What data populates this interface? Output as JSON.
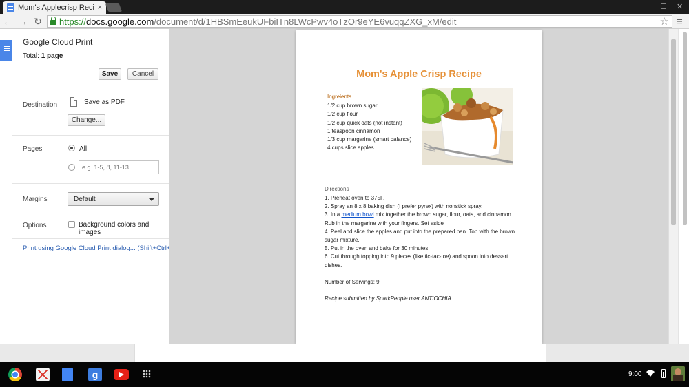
{
  "browser": {
    "tab_title": "Mom's Applecrisp Recipe",
    "tab_close": "×",
    "url_scheme": "https://",
    "url_host": "docs.google.com",
    "url_path": "/document/d/1HBSmEeukUFbiITn8LWcPwv4oTzOr9eYE6vuqqZXG_xM/edit",
    "back": "←",
    "forward": "→",
    "reload": "↻",
    "star": "☆",
    "menu": "≡",
    "minimize": "—",
    "maximize": "☐",
    "close": "✕"
  },
  "print_dialog": {
    "title": "Google Cloud Print",
    "total_label": "Total:",
    "total_value": "1 page",
    "save_label": "Save",
    "cancel_label": "Cancel",
    "destination_label": "Destination",
    "destination_value": "Save as PDF",
    "change_label": "Change...",
    "pages_label": "Pages",
    "pages_all_label": "All",
    "pages_placeholder": "e.g. 1-5, 8, 11-13",
    "margins_label": "Margins",
    "margins_value": "Default",
    "options_label": "Options",
    "background_option": "Background colors and images",
    "cloud_print_link": "Print using Google Cloud Print dialog... (Shift+Ctrl+P)"
  },
  "document": {
    "title": "Mom's Apple Crisp Recipe",
    "ingredients_heading": "Ingreients",
    "ingredients": [
      "1/2 cup brown sugar",
      "1/2 cup flour",
      "1/2 cup quick oats (not instant)",
      "1 teaspoon cinnamon",
      "1/3 cup margarine (smart balance)",
      "4 cups slice apples"
    ],
    "directions_heading": "Directions",
    "directions": [
      "1. Preheat oven to 375F.",
      "2. Spray an 8 x 8 baking dish (I prefer pyrex) with nonstick spray.",
      "4. Peel and slice the apples and put into the prepared pan. Top with the brown sugar mixture.",
      "5. Put in the oven and bake for 30 minutes.",
      "6. Cut through topping into 9 pieces (like tic-tac-toe) and spoon into dessert dishes."
    ],
    "direction_3_pre": "3. In a ",
    "direction_3_link": "medium bowl",
    "direction_3_post": " mix together the brown sugar, flour, oats, and cinnamon. Rub in the margarine with your fingers. Set aside",
    "servings": "Number of Servings: 9",
    "submitted": "Recipe submitted by SparkPeople user ANTIOCHIA."
  },
  "shelf": {
    "time": "9:00",
    "apps": [
      "chrome-icon",
      "gmail-icon",
      "docs-icon",
      "google-plus-icon",
      "youtube-icon",
      "app-launcher-icon"
    ],
    "gplus_glyph": "g"
  },
  "colors": {
    "title_orange": "#e69138",
    "ingredient_heading": "#b45f06",
    "link_blue": "#1155cc",
    "url_green": "#2a8a2a",
    "docs_blue": "#4a86e8"
  }
}
